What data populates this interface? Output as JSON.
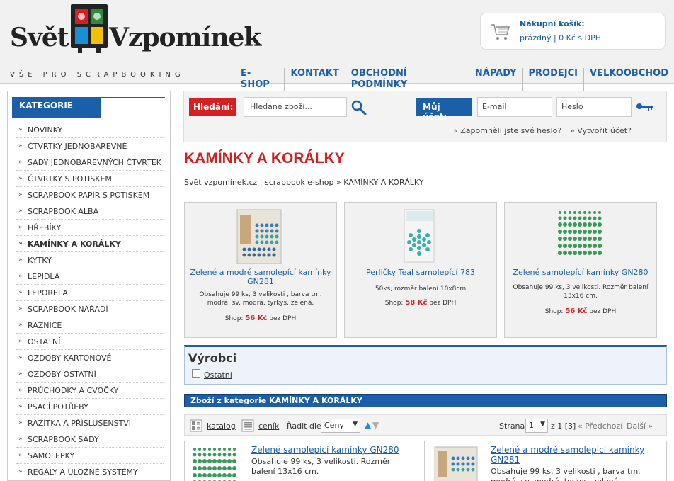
{
  "header": {
    "logo_left": "Svět",
    "logo_right": "Vzpomínek",
    "tagline": "VŠE PRO SCRAPBOOKING",
    "cart_title": "Nákupní košík:",
    "cart_status": "prázdný  |  0 Kč s DPH"
  },
  "nav": [
    "E-SHOP",
    "KONTAKT",
    "OBCHODNÍ PODMÍNKY",
    "NÁPADY",
    "PRODEJCI",
    "VELKOOBCHOD"
  ],
  "sidebar": {
    "title": "KATEGORIE",
    "items": [
      "NOVINKY",
      "ČTVRTKY JEDNOBAREVNÉ",
      "SADY JEDNOBAREVNÝCH ČTVRTEK",
      "ČTVRTKY S POTISKEM",
      "SCRAPBOOK PAPÍR S POTISKEM",
      "SCRAPBOOK ALBA",
      "HŘEBÍKY",
      "KAMÍNKY A KORÁLKY",
      "KYTKY",
      "LEPIDLA",
      "LEPORELA",
      "SCRAPBOOK NÁŘADÍ",
      "RAZNICE",
      "OSTATNÍ",
      "OZDOBY KARTONOVÉ",
      "OZDOBY OSTATNÍ",
      "PRŮCHODKY A CVOČKY",
      "PSACÍ POTŘEBY",
      "RAZÍTKA A PŘÍSLUŠENSTVÍ",
      "SCRAPBOOK SADY",
      "SAMOLEPKY",
      "REGÁLY A ÚLOŽNÉ SYSTÉMY"
    ],
    "active_index": 7
  },
  "search": {
    "label": "Hledání:",
    "placeholder": "Hledané zboží...",
    "account_label": "Můj účet:",
    "email_placeholder": "E-mail",
    "password_placeholder": "Heslo",
    "forgot_link": "Zapomněli jste své heslo?",
    "register_link": "Vytvořit účet?"
  },
  "main": {
    "title": "KAMÍNKY A KORÁLKY",
    "breadcrumb_link": "Svět vzpomínek.cz | scrapbook e-shop",
    "breadcrumb_sep": " » ",
    "breadcrumb_current": "KAMÍNKY A KORÁLKY"
  },
  "featured": [
    {
      "title": "Zelené a modré samolepící kamínky GN281",
      "desc": "Obsahuje 99 ks, 3 velikosti , barva tm. modrá, sv. modrá, tyrkys. zelená.",
      "price_label": "Shop:",
      "price": "56 Kč",
      "price_suffix": "bez DPH"
    },
    {
      "title": "Perličky Teal samolepící 783",
      "desc": "50ks, rozměr balení 10x8cm",
      "price_label": "Shop:",
      "price": "58 Kč",
      "price_suffix": "bez DPH"
    },
    {
      "title": "Zelené samolepící kamínky GN280",
      "desc": "Obsahuje 99 ks, 3 velikosti. Rozměr balení 13x16 cm.",
      "price_label": "Shop:",
      "price": "56 Kč",
      "price_suffix": "bez DPH"
    }
  ],
  "makers": {
    "title": "Výrobci",
    "option": "Ostatní"
  },
  "category_bar": {
    "prefix": "Zboží z kategorie",
    "name": "KAMÍNKY A KORÁLKY"
  },
  "toolbar": {
    "catalog": "katalog",
    "price_list": "ceník",
    "sort_label": "Řadit dle",
    "sort_value": "Ceny",
    "page_label": "Strana",
    "page_value": "1",
    "page_total": "z 1 [3]",
    "prev": "Předchozí",
    "next": "Další"
  },
  "list_items": [
    {
      "title": "Zelené samolepící kamínky GN280",
      "desc": "Obsahuje 99 ks, 3 velikosti. Rozměr balení 13x16 cm."
    },
    {
      "title": "Zelené a modré samolepící kamínky GN281",
      "desc": "Obsahuje 99 ks, 3 velikosti , barva tm. modrá, sv. modrá, tyrkys. zelená."
    }
  ],
  "colors": {
    "accent_blue": "#1a5fa8",
    "accent_red": "#d42020"
  }
}
